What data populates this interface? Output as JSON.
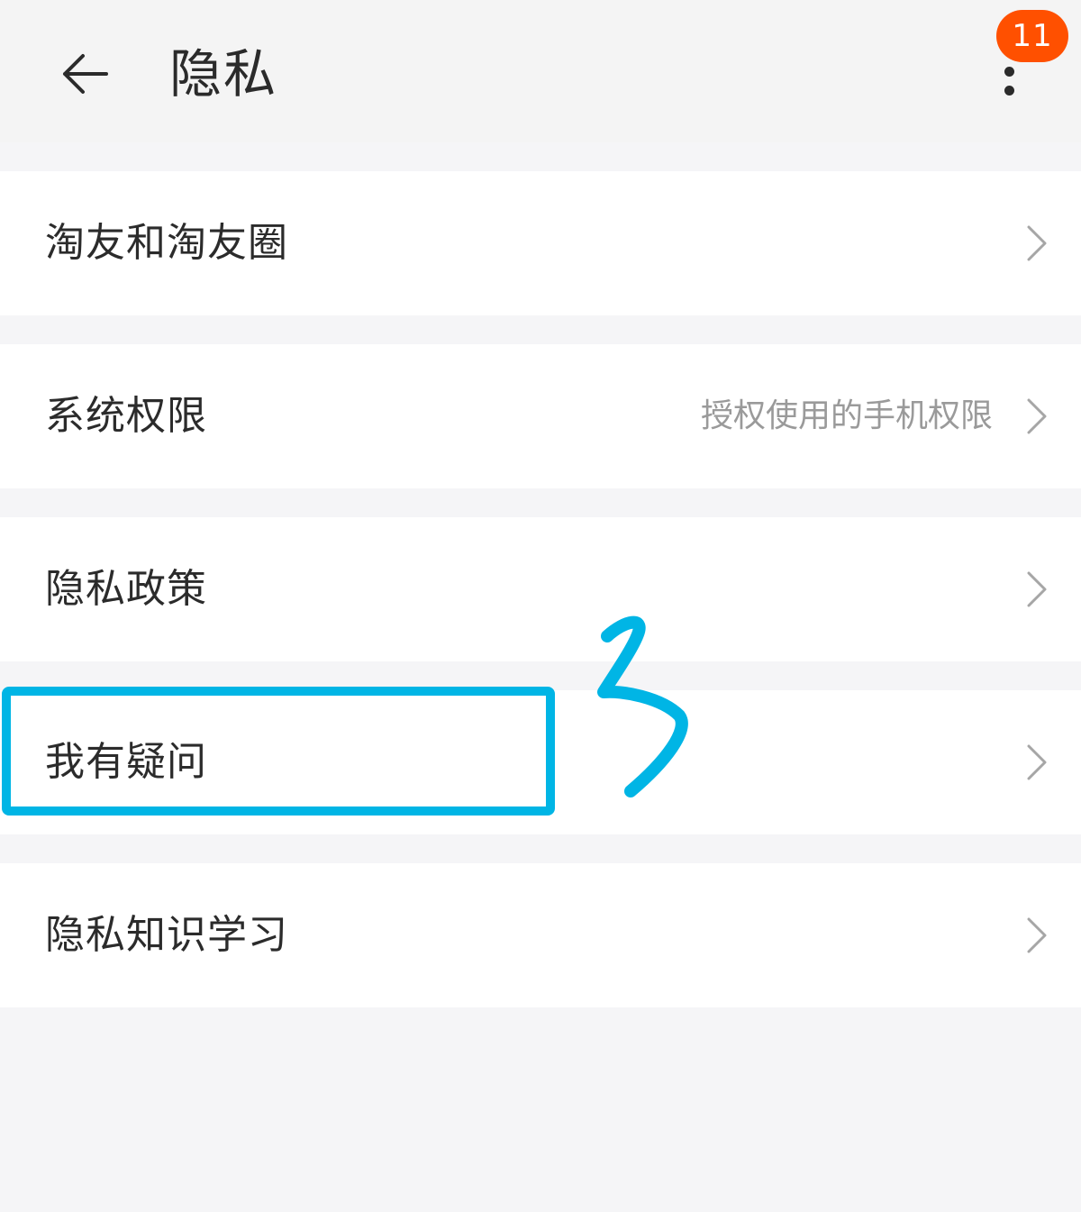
{
  "header": {
    "title": "隐私",
    "back_icon": "arrow-left-icon",
    "more_icon": "more-vertical-icon",
    "badge_count": "11",
    "badge_color": "#ff5000"
  },
  "menu": {
    "items": [
      {
        "label": "淘友和淘友圈",
        "value": "",
        "chevron_icon": "chevron-right-icon"
      },
      {
        "label": "系统权限",
        "value": "授权使用的手机权限",
        "chevron_icon": "chevron-right-icon"
      },
      {
        "label": "隐私政策",
        "value": "",
        "chevron_icon": "chevron-right-icon"
      },
      {
        "label": "我有疑问",
        "value": "",
        "chevron_icon": "chevron-right-icon"
      },
      {
        "label": "隐私知识学习",
        "value": "",
        "chevron_icon": "chevron-right-icon"
      }
    ]
  },
  "annotation": {
    "color": "#00b5e5",
    "highlighted_item": "我有疑问"
  }
}
